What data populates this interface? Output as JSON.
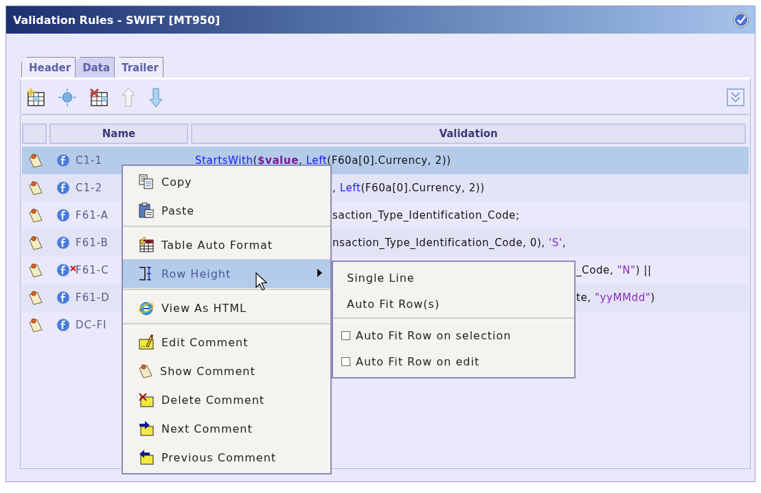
{
  "window": {
    "title": "Validation Rules - SWIFT [MT950]"
  },
  "tabs": [
    {
      "label": "Header",
      "selected": false
    },
    {
      "label": "Data",
      "selected": true
    },
    {
      "label": "Trailer",
      "selected": false
    }
  ],
  "table": {
    "columns": [
      "Name",
      "Validation"
    ],
    "rows": [
      {
        "name": "C1-1",
        "selected": true,
        "error": false,
        "validation": [
          {
            "text": "StartsWith",
            "kind": "function"
          },
          {
            "text": "(",
            "kind": "plain"
          },
          {
            "text": "$value",
            "kind": "variable"
          },
          {
            "text": ", ",
            "kind": "plain"
          },
          {
            "text": "Left",
            "kind": "function"
          },
          {
            "text": "(F60a[0].Currency, 2))",
            "kind": "plain"
          }
        ]
      },
      {
        "name": "C1-2",
        "selected": false,
        "error": false,
        "validation": [
          {
            "text": ", ",
            "kind": "plain"
          },
          {
            "text": "Left",
            "kind": "function"
          },
          {
            "text": "(F60a[0].Currency, 2))",
            "kind": "plain"
          }
        ]
      },
      {
        "name": "F61-A",
        "selected": false,
        "error": false,
        "validation": [
          {
            "text": "saction_Type_Identification_Code;",
            "kind": "plain"
          }
        ]
      },
      {
        "name": "F61-B",
        "selected": false,
        "error": false,
        "validation": [
          {
            "text": "nsaction_Type_Identification_Code, 0), ",
            "kind": "plain"
          },
          {
            "text": "'S'",
            "kind": "string"
          },
          {
            "text": ",",
            "kind": "plain"
          }
        ]
      },
      {
        "name": "F61-C",
        "selected": false,
        "error": true,
        "validation": [
          {
            "text": "_Code, ",
            "kind": "plain"
          },
          {
            "text": "\"N\"",
            "kind": "string"
          },
          {
            "text": ") ||",
            "kind": "plain"
          }
        ]
      },
      {
        "name": "F61-D",
        "selected": false,
        "error": false,
        "validation": [
          {
            "text": "te, ",
            "kind": "plain"
          },
          {
            "text": "\"yyMMdd\"",
            "kind": "string"
          },
          {
            "text": ")",
            "kind": "plain"
          }
        ]
      },
      {
        "name": "DC-FI",
        "selected": false,
        "error": false
      }
    ]
  },
  "context_menu": {
    "items": [
      {
        "kind": "item",
        "label": "Copy",
        "highlighted": false
      },
      {
        "kind": "item",
        "label": "Paste",
        "highlighted": false
      },
      {
        "kind": "separator"
      },
      {
        "kind": "item",
        "label": "Table Auto Format",
        "highlighted": false
      },
      {
        "kind": "item",
        "label": "Row Height",
        "highlighted": true,
        "submenu": [
          {
            "kind": "item",
            "label": "Single Line",
            "highlighted": false
          },
          {
            "kind": "item",
            "label": "Auto Fit Row(s)",
            "highlighted": false
          },
          {
            "kind": "separator"
          },
          {
            "kind": "check",
            "label": "Auto Fit Row on selection",
            "checked": false
          },
          {
            "kind": "check",
            "label": "Auto Fit Row on edit",
            "checked": false
          }
        ]
      },
      {
        "kind": "separator"
      },
      {
        "kind": "item",
        "label": "View As HTML",
        "highlighted": false
      },
      {
        "kind": "separator"
      },
      {
        "kind": "item",
        "label": "Edit Comment",
        "highlighted": false
      },
      {
        "kind": "item",
        "label": "Show Comment",
        "highlighted": false
      },
      {
        "kind": "item",
        "label": "Delete Comment",
        "highlighted": false
      },
      {
        "kind": "item",
        "label": "Next Comment",
        "highlighted": false
      },
      {
        "kind": "item",
        "label": "Previous Comment",
        "highlighted": false
      }
    ]
  }
}
